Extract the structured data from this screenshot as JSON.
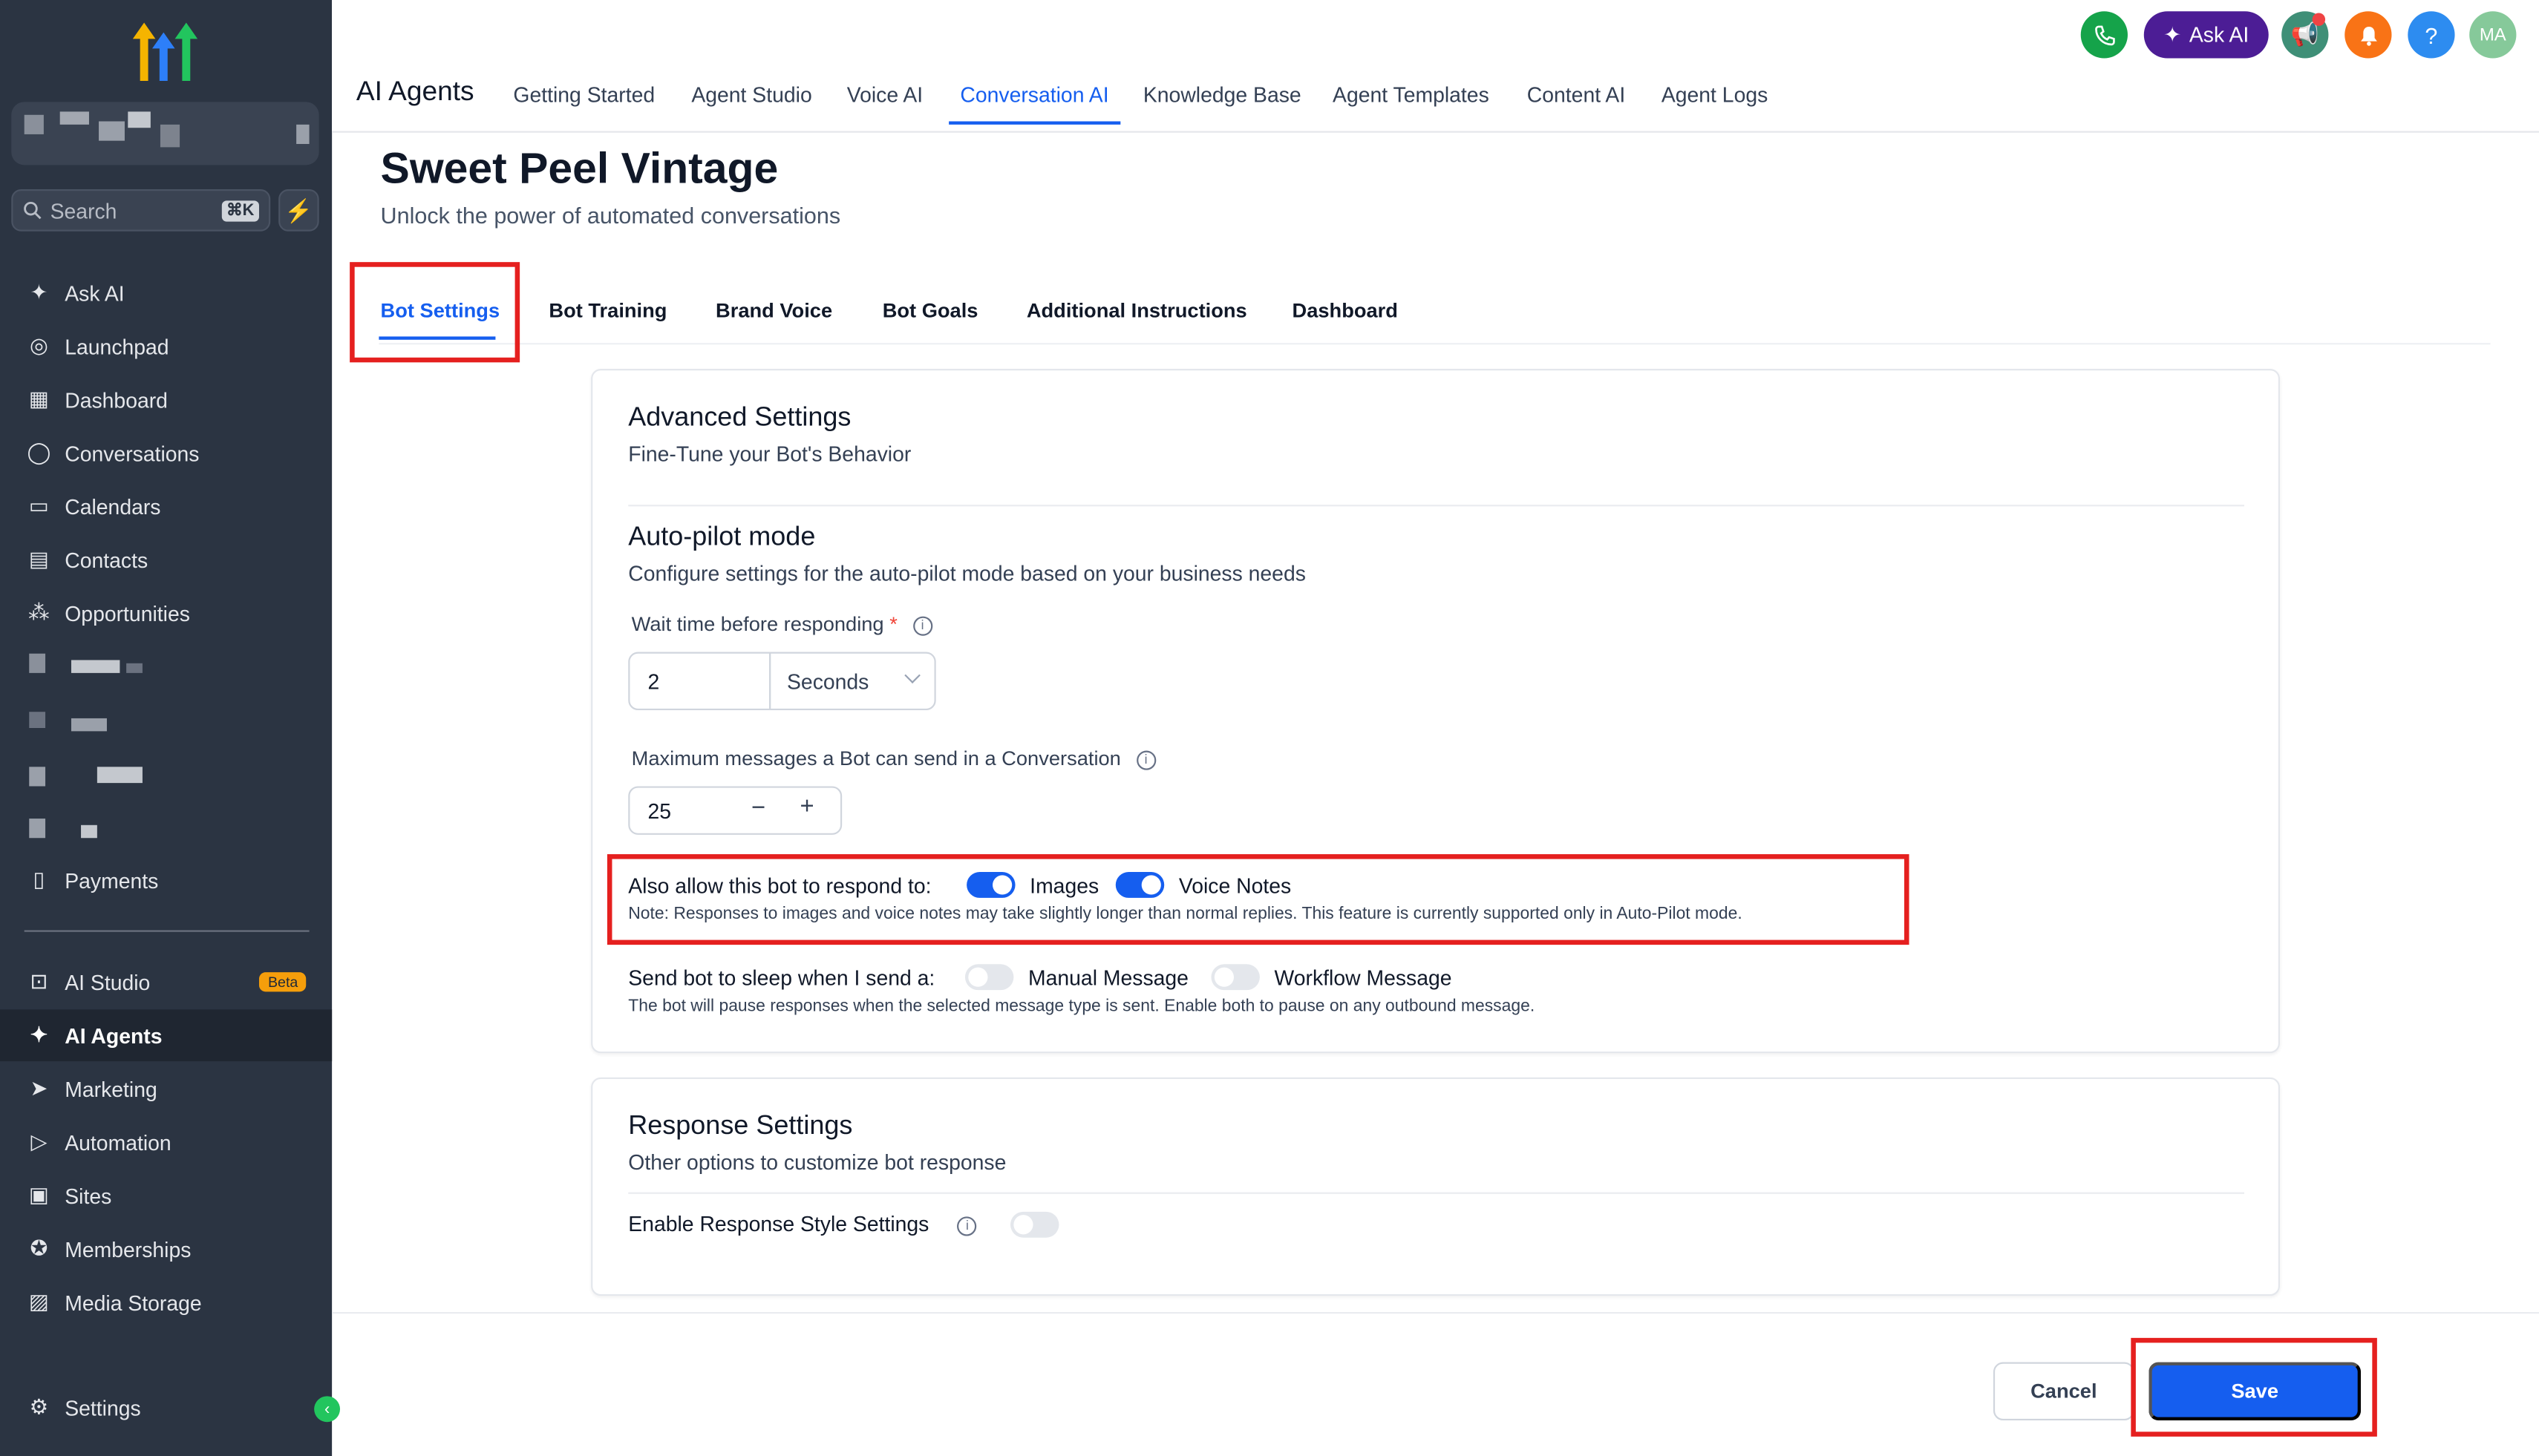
{
  "sidebar": {
    "search_placeholder": "Search",
    "search_shortcut": "⌘K",
    "items": [
      {
        "label": "Ask AI",
        "icon": "sparkle-icon"
      },
      {
        "label": "Launchpad",
        "icon": "rocket-icon"
      },
      {
        "label": "Dashboard",
        "icon": "grid-icon"
      },
      {
        "label": "Conversations",
        "icon": "chat-bubble-icon"
      },
      {
        "label": "Calendars",
        "icon": "calendar-icon"
      },
      {
        "label": "Contacts",
        "icon": "contacts-icon"
      },
      {
        "label": "Opportunities",
        "icon": "network-icon"
      },
      {
        "label": "Payments",
        "icon": "invoice-icon"
      },
      {
        "label": "AI Studio",
        "icon": "ai-studio-icon",
        "badge": "Beta"
      },
      {
        "label": "AI Agents",
        "icon": "sparkle-icon",
        "active": true
      },
      {
        "label": "Marketing",
        "icon": "send-icon"
      },
      {
        "label": "Automation",
        "icon": "play-circle-icon"
      },
      {
        "label": "Sites",
        "icon": "site-icon"
      },
      {
        "label": "Memberships",
        "icon": "award-icon"
      },
      {
        "label": "Media Storage",
        "icon": "image-icon"
      },
      {
        "label": "Settings",
        "icon": "gear-icon"
      }
    ]
  },
  "header": {
    "title": "AI Agents",
    "tabs": [
      "Getting Started",
      "Agent Studio",
      "Voice AI",
      "Conversation AI",
      "Knowledge Base",
      "Agent Templates",
      "Content AI",
      "Agent Logs"
    ],
    "active_tab": "Conversation AI",
    "ask_ai_label": "Ask AI",
    "help_label": "?",
    "avatar_initials": "MA"
  },
  "page": {
    "title": "Sweet Peel Vintage",
    "subtitle": "Unlock the power of automated conversations",
    "tabs": [
      "Bot Settings",
      "Bot Training",
      "Brand Voice",
      "Bot Goals",
      "Additional Instructions",
      "Dashboard"
    ],
    "active_tab": "Bot Settings"
  },
  "advanced": {
    "title": "Advanced Settings",
    "subtitle": "Fine-Tune your Bot's Behavior",
    "autopilot_title": "Auto-pilot mode",
    "autopilot_desc": "Configure settings for the auto-pilot mode based on your business needs",
    "wait_label": "Wait time before responding",
    "wait_required": "*",
    "wait_value": "2",
    "wait_unit": "Seconds",
    "max_label": "Maximum messages a Bot can send in a Conversation",
    "max_value": "25",
    "respond_label": "Also allow this bot to respond to:",
    "respond_images": "Images",
    "respond_voice": "Voice Notes",
    "respond_images_on": true,
    "respond_voice_on": true,
    "respond_note": "Note: Responses to images and voice notes may take slightly longer than normal replies. This feature is currently supported only in Auto-Pilot mode.",
    "sleep_label": "Send bot to sleep when I send a:",
    "sleep_manual": "Manual Message",
    "sleep_workflow": "Workflow Message",
    "sleep_manual_on": false,
    "sleep_workflow_on": false,
    "sleep_note": "The bot will pause responses when the selected message type is sent. Enable both to pause on any outbound message."
  },
  "response": {
    "title": "Response Settings",
    "subtitle": "Other options to customize bot response",
    "style_label": "Enable Response Style Settings",
    "style_on": false
  },
  "footer": {
    "cancel_label": "Cancel",
    "save_label": "Save"
  },
  "colors": {
    "accent": "#155eef",
    "sidebar_bg": "#2b3442",
    "highlight": "#e5201f"
  }
}
